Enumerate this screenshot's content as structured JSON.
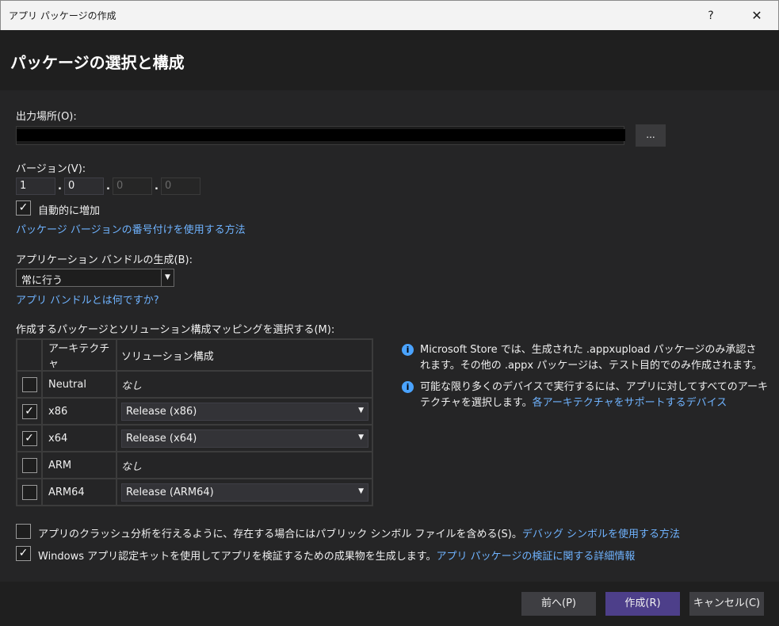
{
  "window": {
    "title": "アプリ パッケージの作成",
    "help": "?",
    "close": "✕"
  },
  "header": {
    "title": "パッケージの選択と構成"
  },
  "output": {
    "label": "出力場所(O):",
    "browse": "..."
  },
  "version": {
    "label": "バージョン(V):",
    "parts": [
      "1",
      "0",
      "0",
      "0"
    ],
    "sep": ".",
    "auto_increment": "自動的に増加",
    "auto_checked": true,
    "link": "パッケージ バージョンの番号付けを使用する方法"
  },
  "bundle": {
    "label": "アプリケーション バンドルの生成(B):",
    "selected": "常に行う",
    "link": "アプリ バンドルとは何ですか?"
  },
  "mapping": {
    "label": "作成するパッケージとソリューション構成マッピングを選択する(M):",
    "headers": [
      "アーキテクチャ",
      "ソリューション構成"
    ],
    "rows": [
      {
        "arch": "Neutral",
        "checked": false,
        "config": "なし",
        "dropdown": false
      },
      {
        "arch": "x86",
        "checked": true,
        "config": "Release (x86)",
        "dropdown": true
      },
      {
        "arch": "x64",
        "checked": true,
        "config": "Release (x64)",
        "dropdown": true
      },
      {
        "arch": "ARM",
        "checked": false,
        "config": "なし",
        "dropdown": false
      },
      {
        "arch": "ARM64",
        "checked": false,
        "config": "Release (ARM64)",
        "dropdown": true
      }
    ]
  },
  "info": {
    "line1a": "Microsoft Store では、生成された .appxupload パッケージのみ承認さ",
    "line1b": "れます。その他の .appx パッケージは、テスト目的でのみ作成されます。",
    "line2a": "可能な限り多くのデバイスで実行するには、アプリに対してすべてのアーキ",
    "line2b": "テクチャを選択します。",
    "line2_link": "各アーキテクチャをサポートするデバイス"
  },
  "options": {
    "crash_text": "アプリのクラッシュ分析を行えるように、存在する場合にはパブリック シンボル ファイルを含める(S)。",
    "crash_link": "デバッグ シンボルを使用する方法",
    "crash_checked": false,
    "wack_text": "Windows アプリ認定キットを使用してアプリを検証するための成果物を生成します。",
    "wack_link": "アプリ パッケージの検証に関する詳細情報",
    "wack_checked": true
  },
  "footer": {
    "back": "前へ(P)",
    "create": "作成(R)",
    "cancel": "キャンセル(C)"
  },
  "icons": {
    "check": "✓",
    "info": "i",
    "dropdown": "▼"
  },
  "colors": {
    "link": "#6fb3ff",
    "primary_button": "#4d3f8a",
    "info_icon": "#4aa3ff"
  }
}
